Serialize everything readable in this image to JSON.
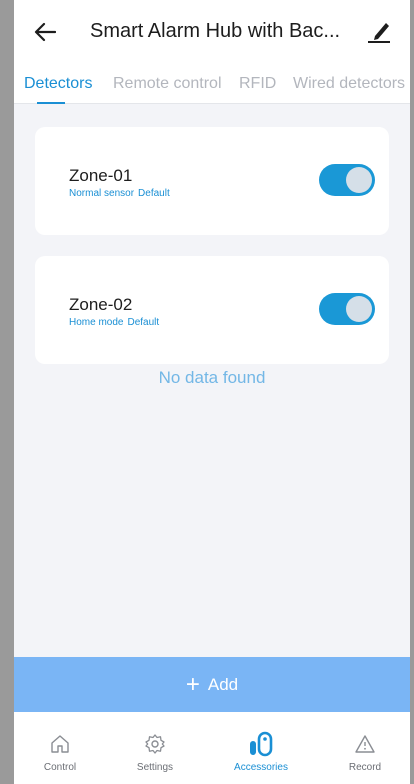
{
  "header": {
    "title": "Smart Alarm Hub with Bac..."
  },
  "tabs": [
    {
      "label": "Detectors",
      "active": true
    },
    {
      "label": "Remote control",
      "active": false
    },
    {
      "label": "RFID",
      "active": false
    },
    {
      "label": "Wired detectors",
      "active": false
    }
  ],
  "zones": [
    {
      "name": "Zone-01",
      "type": "Normal sensor",
      "mode": "Default",
      "enabled": true
    },
    {
      "name": "Zone-02",
      "type": "Home mode",
      "mode": "Default",
      "enabled": true
    }
  ],
  "empty_message": "No data found",
  "add_button": {
    "icon": "+",
    "label": "Add"
  },
  "bottom_nav": [
    {
      "label": "Control",
      "icon": "home-icon",
      "active": false
    },
    {
      "label": "Settings",
      "icon": "gear-icon",
      "active": false
    },
    {
      "label": "Accessories",
      "icon": "accessories-icon",
      "active": true
    },
    {
      "label": "Record",
      "icon": "warning-icon",
      "active": false
    }
  ],
  "colors": {
    "accent": "#1a8fd4",
    "toggle_on": "#1a98d6",
    "add_button": "#7ab5f5",
    "background": "#f3f4f8"
  }
}
